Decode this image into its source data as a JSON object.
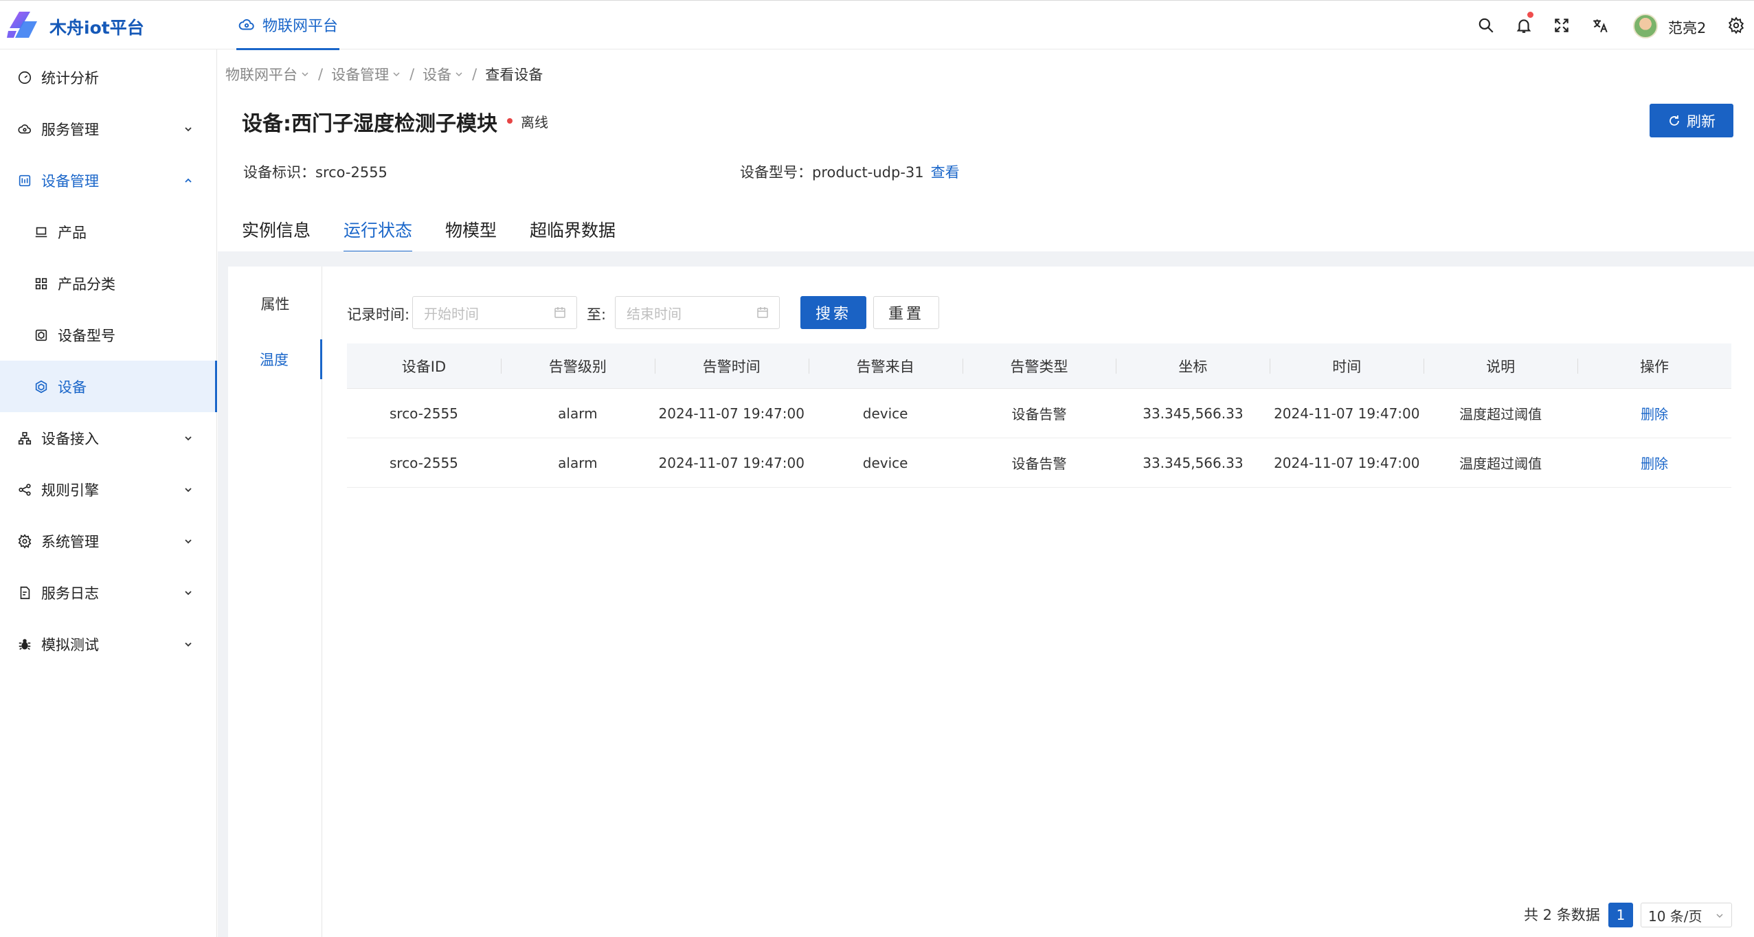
{
  "app": {
    "name": "木舟iot平台",
    "top_tab": "物联网平台",
    "username": "范亮2"
  },
  "colors": {
    "primary": "#1a62c4",
    "offline": "#e64545",
    "selected_bg": "#e9f1fc"
  },
  "header_icons": [
    "search-icon",
    "bell-icon",
    "fullscreen-icon",
    "translate-icon",
    "avatar",
    "gear-icon"
  ],
  "sidebar": {
    "items": [
      {
        "label": "统计分析",
        "icon": "dashboard-icon"
      },
      {
        "label": "服务管理",
        "icon": "cloud-icon"
      },
      {
        "label": "设备管理",
        "icon": "device-manage-icon"
      },
      {
        "label": "产品",
        "icon": "laptop-icon"
      },
      {
        "label": "产品分类",
        "icon": "grid-icon"
      },
      {
        "label": "设备型号",
        "icon": "cube-icon"
      },
      {
        "label": "设备",
        "icon": "box-icon"
      },
      {
        "label": "设备接入",
        "icon": "network-icon"
      },
      {
        "label": "规则引擎",
        "icon": "share-icon"
      },
      {
        "label": "系统管理",
        "icon": "settings-icon"
      },
      {
        "label": "服务日志",
        "icon": "log-icon"
      },
      {
        "label": "模拟测试",
        "icon": "bug-icon"
      }
    ]
  },
  "breadcrumb": [
    "物联网平台",
    "设备管理",
    "设备",
    "查看设备"
  ],
  "device": {
    "title": "设备:西门子湿度检测子模块",
    "status": "离线",
    "refresh_label": "刷新",
    "id_label": "设备标识：",
    "id_value": "srco-2555",
    "model_label": "设备型号：",
    "model_value": "product-udp-31",
    "model_link": "查看"
  },
  "tabs": [
    "实例信息",
    "运行状态",
    "物模型",
    "超临界数据"
  ],
  "vtabs": [
    "属性",
    "温度"
  ],
  "filter": {
    "label": "记录时间:",
    "start_placeholder": "开始时间",
    "to_label": "至:",
    "end_placeholder": "结束时间",
    "search_label": "搜索",
    "reset_label": "重置"
  },
  "table": {
    "columns": [
      "设备ID",
      "告警级别",
      "告警时间",
      "告警来自",
      "告警类型",
      "坐标",
      "时间",
      "说明",
      "操作"
    ],
    "rows": [
      [
        "srco-2555",
        "alarm",
        "2024-11-07 19:47:00",
        "device",
        "设备告警",
        "33.345,566.33",
        "2024-11-07 19:47:00",
        "温度超过阈值",
        "删除"
      ],
      [
        "srco-2555",
        "alarm",
        "2024-11-07 19:47:00",
        "device",
        "设备告警",
        "33.345,566.33",
        "2024-11-07 19:47:00",
        "温度超过阈值",
        "删除"
      ]
    ]
  },
  "pagination": {
    "total_text": "共 2 条数据",
    "current_page": "1",
    "page_size": "10 条/页"
  }
}
